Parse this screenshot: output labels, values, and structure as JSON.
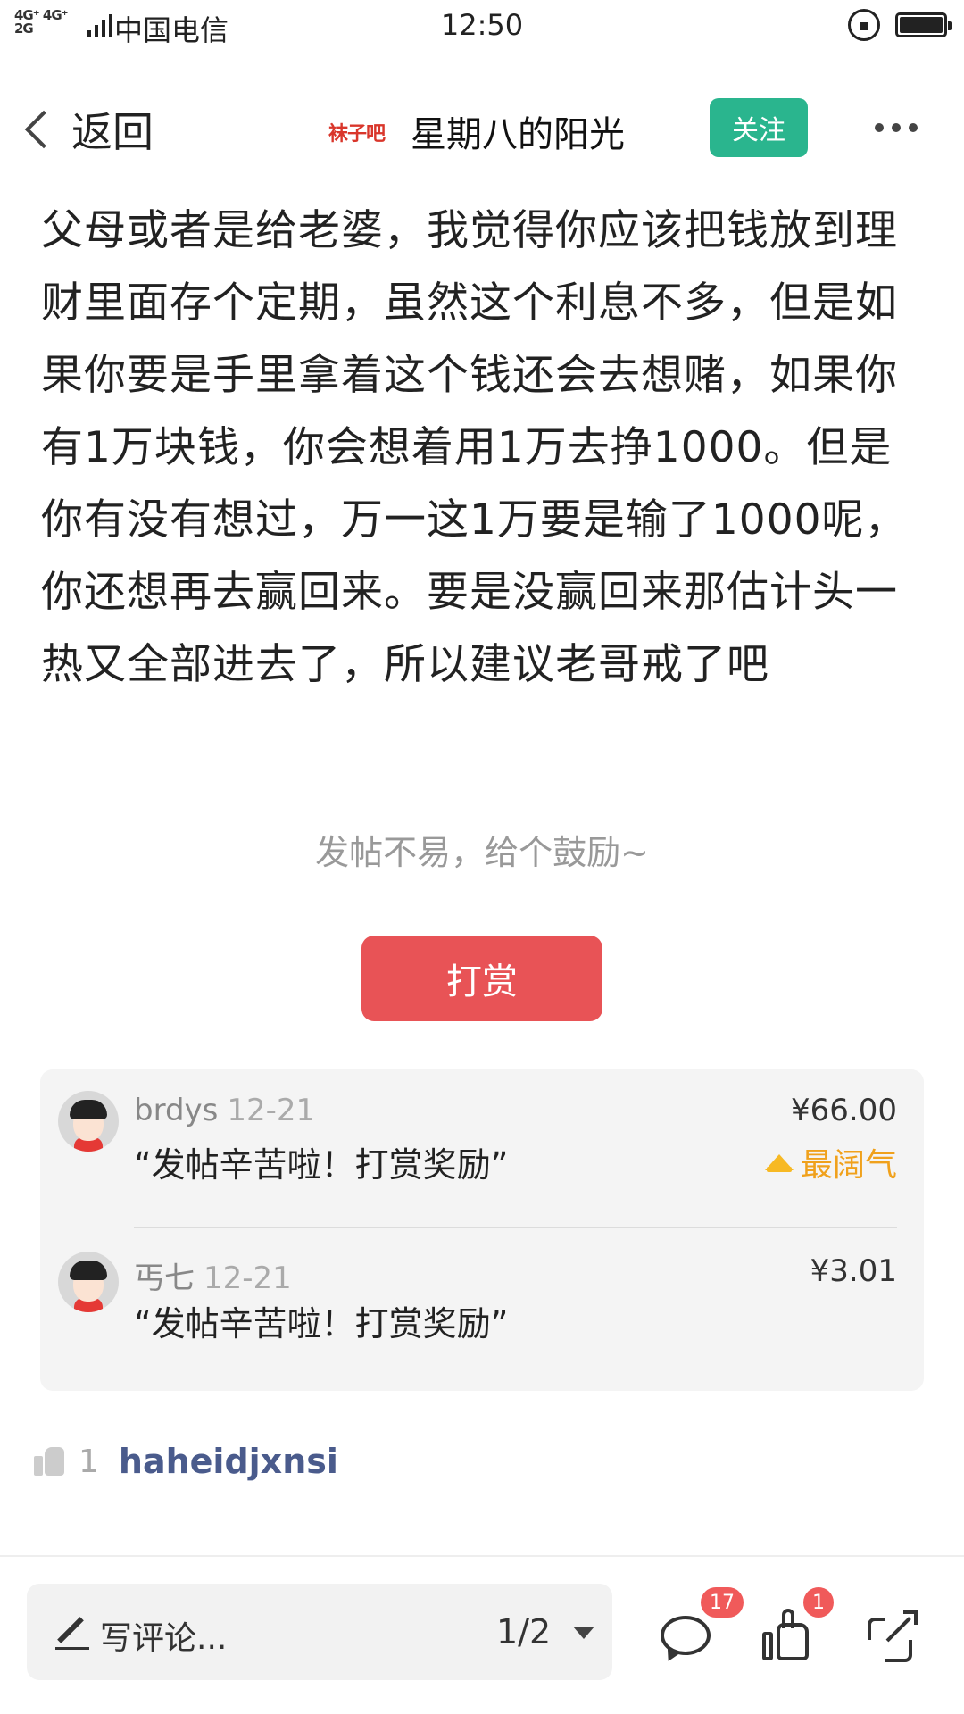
{
  "status_bar": {
    "network": "4G⁺ 4G⁺\n2G",
    "carrier": "中国电信",
    "time": "12:50"
  },
  "header": {
    "back_label": "返回",
    "logo_text": "袜子吧",
    "author": "星期八的阳光",
    "follow_label": "关注"
  },
  "article": {
    "text": "父母或者是给老婆，我觉得你应该把钱放到理财里面存个定期，虽然这个利息不多，但是如果你要是手里拿着这个钱还会去想赌，如果你有1万块钱，你会想着用1万去挣1000。但是你有没有想过，万一这1万要是输了1000呢，你还想再去赢回来。要是没赢回来那估计头一热又全部进去了，所以建议老哥戒了吧"
  },
  "reward": {
    "encourage_text": "发帖不易，给个鼓励~",
    "button_label": "打赏",
    "items": [
      {
        "name": "brdys",
        "date": "12-21",
        "message": "“发帖辛苦啦！打赏奖励”",
        "amount": "¥66.00",
        "badge": "最阔气"
      },
      {
        "name": "丐七",
        "date": "12-21",
        "message": "“发帖辛苦啦！打赏奖励”",
        "amount": "¥3.01"
      }
    ]
  },
  "likes": {
    "count": "1",
    "user": "haheidjxnsi"
  },
  "bottom_bar": {
    "comment_placeholder": "写评论...",
    "page_indicator": "1/2",
    "comment_count": "17",
    "like_count": "1"
  },
  "colors": {
    "follow_green": "#2ab58e",
    "reward_red": "#e85356",
    "badge_gold": "#f0a11c",
    "link_blue": "#4a5b8c"
  },
  "icons": [
    "back-chevron-icon",
    "more-icon",
    "crown-icon",
    "like-icon",
    "pencil-icon",
    "dropdown-icon",
    "chat-icon",
    "thumb-icon",
    "share-icon"
  ]
}
